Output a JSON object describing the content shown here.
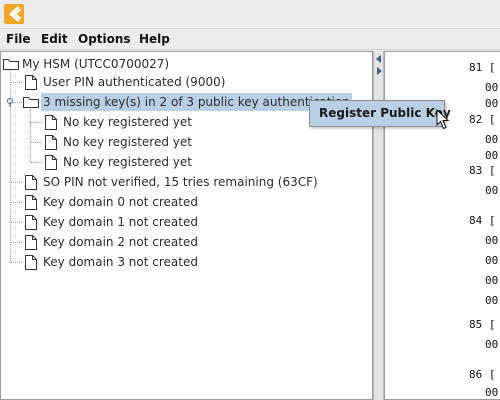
{
  "menubar": {
    "items": [
      "File",
      "Edit",
      "Options",
      "Help"
    ]
  },
  "tree": {
    "root": "My HSM (UTCC0700027)",
    "nodes": [
      "User PIN authenticated (9000)",
      "3 missing key(s) in 2 of 3 public key authentication",
      "No key registered yet",
      "No key registered yet",
      "No key registered yet",
      "SO PIN not verified, 15 tries remaining (63CF)",
      "Key domain 0 not created",
      "Key domain 1 not created",
      "Key domain 2 not created",
      "Key domain 3 not created"
    ]
  },
  "context_menu": {
    "item": "Register Public Key"
  },
  "hex_view": {
    "lines": [
      "81 [",
      "00",
      "00",
      "82 [",
      "00",
      "00",
      "83 [",
      "00",
      "84 [",
      "00",
      "00",
      "00",
      "00",
      "85 [",
      "00",
      "86 [",
      "00",
      "00"
    ]
  },
  "colors": {
    "selection": "#b8cfe5",
    "app_icon": "#f0a626",
    "tree_line": "#8aa0b8"
  }
}
